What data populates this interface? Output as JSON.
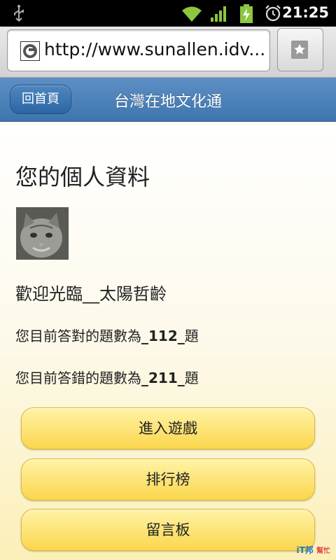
{
  "status_bar": {
    "time": "21:25"
  },
  "browser": {
    "url": "http://www.sunallen.idv...."
  },
  "header": {
    "home_label": "回首頁",
    "title": "台灣在地文化通"
  },
  "profile": {
    "title": "您的個人資料",
    "welcome": "歡迎光臨__太陽哲齡",
    "correct_prefix": "您目前答對的題數為",
    "correct_count": "_112_",
    "correct_suffix": "題",
    "wrong_prefix": "您目前答錯的題數為",
    "wrong_count": "_211_",
    "wrong_suffix": "題"
  },
  "menu": {
    "enter_game": "進入遊戲",
    "leaderboard": "排行榜",
    "message_board": "留言板"
  },
  "watermark": {
    "brand": "iT邦",
    "sub": "幫忙"
  },
  "colors": {
    "header": "#4a80ba",
    "button_yellow": "#fbd64c",
    "status_bar": "#000000"
  }
}
